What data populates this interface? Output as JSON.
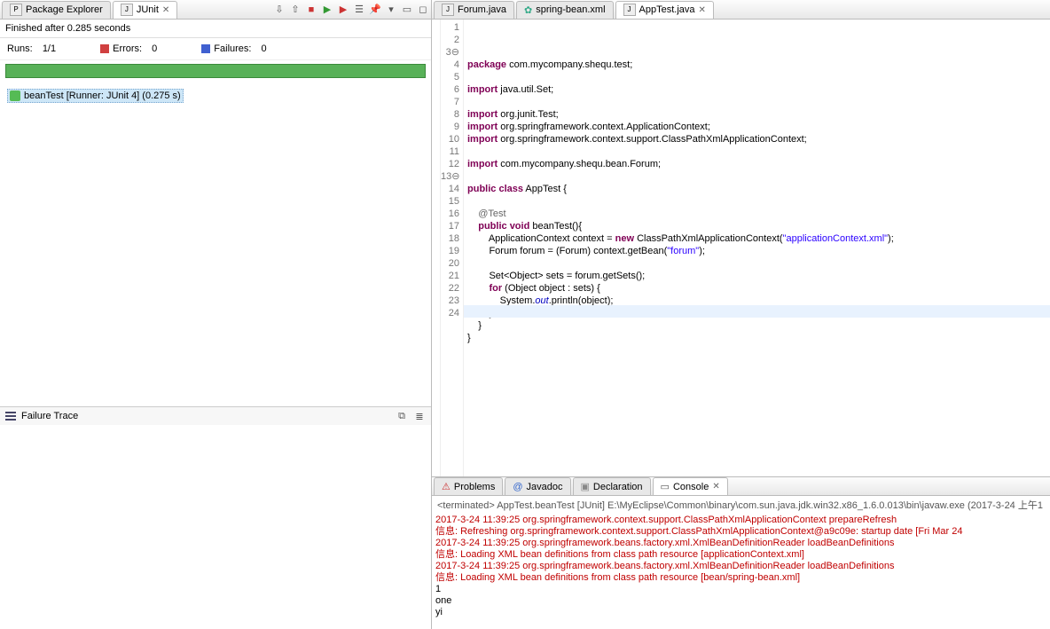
{
  "left_tabs": {
    "package_explorer": "Package Explorer",
    "junit": "JUnit"
  },
  "junit": {
    "status": "Finished after 0.285 seconds",
    "runs_label": "Runs:",
    "runs_value": "1/1",
    "errors_label": "Errors:",
    "errors_value": "0",
    "failures_label": "Failures:",
    "failures_value": "0",
    "tree_item": "beanTest [Runner: JUnit 4] (0.275 s)",
    "failure_trace_label": "Failure Trace"
  },
  "editor_tabs": {
    "forum": "Forum.java",
    "spring_bean": "spring-bean.xml",
    "apptest": "AppTest.java"
  },
  "code": {
    "lines": [
      {
        "n": "1",
        "html": "<span class='kw'>package</span> com.mycompany.shequ.test;"
      },
      {
        "n": "2",
        "html": ""
      },
      {
        "n": "3",
        "html": "<span class='kw'>import</span> java.util.Set;",
        "fold": true
      },
      {
        "n": "4",
        "html": ""
      },
      {
        "n": "5",
        "html": "<span class='kw'>import</span> org.junit.Test;"
      },
      {
        "n": "6",
        "html": "<span class='kw'>import</span> org.springframework.context.ApplicationContext;"
      },
      {
        "n": "7",
        "html": "<span class='kw'>import</span> org.springframework.context.support.ClassPathXmlApplicationContext;"
      },
      {
        "n": "8",
        "html": ""
      },
      {
        "n": "9",
        "html": "<span class='kw'>import</span> com.mycompany.shequ.bean.Forum;"
      },
      {
        "n": "10",
        "html": ""
      },
      {
        "n": "11",
        "html": "<span class='kw'>public</span> <span class='kw'>class</span> AppTest {"
      },
      {
        "n": "12",
        "html": ""
      },
      {
        "n": "13",
        "html": "    <span class='ann'>@Test</span>",
        "fold": true
      },
      {
        "n": "14",
        "html": "    <span class='kw'>public</span> <span class='kw'>void</span> beanTest(){"
      },
      {
        "n": "15",
        "html": "        ApplicationContext context = <span class='kw'>new</span> ClassPathXmlApplicationContext(<span class='str'>\"applicationContext.xml\"</span>);"
      },
      {
        "n": "16",
        "html": "        Forum forum = (Forum) context.getBean(<span class='str'>\"forum\"</span>);"
      },
      {
        "n": "17",
        "html": ""
      },
      {
        "n": "18",
        "html": "        Set&lt;Object&gt; sets = forum.getSets();"
      },
      {
        "n": "19",
        "html": "        <span class='kw'>for</span> (Object object : sets) {"
      },
      {
        "n": "20",
        "html": "            System.<span class='fld'>out</span>.println(object);"
      },
      {
        "n": "21",
        "html": "        }"
      },
      {
        "n": "22",
        "html": "    }"
      },
      {
        "n": "23",
        "html": "}"
      },
      {
        "n": "24",
        "html": ""
      }
    ]
  },
  "bottom_tabs": {
    "problems": "Problems",
    "javadoc": "Javadoc",
    "declaration": "Declaration",
    "console": "Console"
  },
  "console": {
    "header": "<terminated> AppTest.beanTest [JUnit] E:\\MyEclipse\\Common\\binary\\com.sun.java.jdk.win32.x86_1.6.0.013\\bin\\javaw.exe (2017-3-24 上午1",
    "lines": [
      {
        "cls": "log-red",
        "text": "2017-3-24 11:39:25 org.springframework.context.support.ClassPathXmlApplicationContext prepareRefresh"
      },
      {
        "cls": "log-red",
        "text": "信息: Refreshing org.springframework.context.support.ClassPathXmlApplicationContext@a9c09e: startup date [Fri Mar 24"
      },
      {
        "cls": "log-red",
        "text": "2017-3-24 11:39:25 org.springframework.beans.factory.xml.XmlBeanDefinitionReader loadBeanDefinitions"
      },
      {
        "cls": "log-red",
        "text": "信息: Loading XML bean definitions from class path resource [applicationContext.xml]"
      },
      {
        "cls": "log-red",
        "text": "2017-3-24 11:39:25 org.springframework.beans.factory.xml.XmlBeanDefinitionReader loadBeanDefinitions"
      },
      {
        "cls": "log-red",
        "text": "信息: Loading XML bean definitions from class path resource [bean/spring-bean.xml]"
      },
      {
        "cls": "log-black",
        "text": "1"
      },
      {
        "cls": "log-black",
        "text": "one"
      },
      {
        "cls": "log-black",
        "text": "yi"
      }
    ]
  }
}
